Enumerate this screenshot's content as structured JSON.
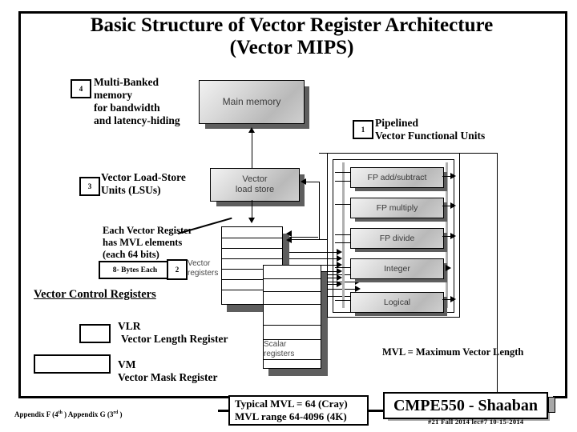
{
  "slide": {
    "title_line1": "Basic Structure of Vector Register Architecture",
    "title_line2": "(Vector MIPS)"
  },
  "annotations": {
    "memory": {
      "badge": "4",
      "line1": "Multi-Banked",
      "line2": "memory",
      "line3": "for bandwidth",
      "line4": "and latency-hiding"
    },
    "functional_units": {
      "badge": "1",
      "line1": "Pipelined",
      "line2": "Vector Functional Units"
    },
    "load_store": {
      "badge": "3",
      "line1": "Vector Load-Store",
      "line2": "Units  (LSUs)"
    },
    "vector_registers": {
      "badge": "2",
      "line1": "Each Vector Register",
      "line2": "has MVL elements",
      "line3": "(each 64 bits)",
      "bytes_box": "8- Bytes Each"
    },
    "mvl_note": "MVL = Maximum Vector Length"
  },
  "diagram": {
    "main_memory": "Main memory",
    "vector_load_store_l1": "Vector",
    "vector_load_store_l2": "load store",
    "vector_registers_l1": "Vector",
    "vector_registers_l2": "registers",
    "scalar_registers_l1": "Scalar",
    "scalar_registers_l2": "registers",
    "functional_units": [
      "FP add/subtract",
      "FP multiply",
      "FP divide",
      "Integer",
      "Logical"
    ]
  },
  "control_registers": {
    "heading": "Vector Control Registers",
    "vlr_abbr": "VLR",
    "vlr_name": "Vector Length Register",
    "vm_abbr": "VM",
    "vm_name": "Vector Mask Register"
  },
  "footer": {
    "appendix_a": "Appendix F (4",
    "appendix_a_sup": "th",
    "appendix_b": " ) Appendix G (3",
    "appendix_b_sup": "rd",
    "appendix_c": " )",
    "mvl_line1": "Typical MVL = 64  (Cray)",
    "mvl_line2": "MVL range 64-4096 (4K)",
    "brand": "CMPE550 - Shaaban",
    "meta": "#21   Fall 2014   lec#7   10-15-2014"
  },
  "colors": {
    "box_fill_light": "#f2f2f2",
    "box_fill_dark": "#b9b9b9",
    "shadow": "#5e5e5e",
    "frame": "#000000"
  }
}
